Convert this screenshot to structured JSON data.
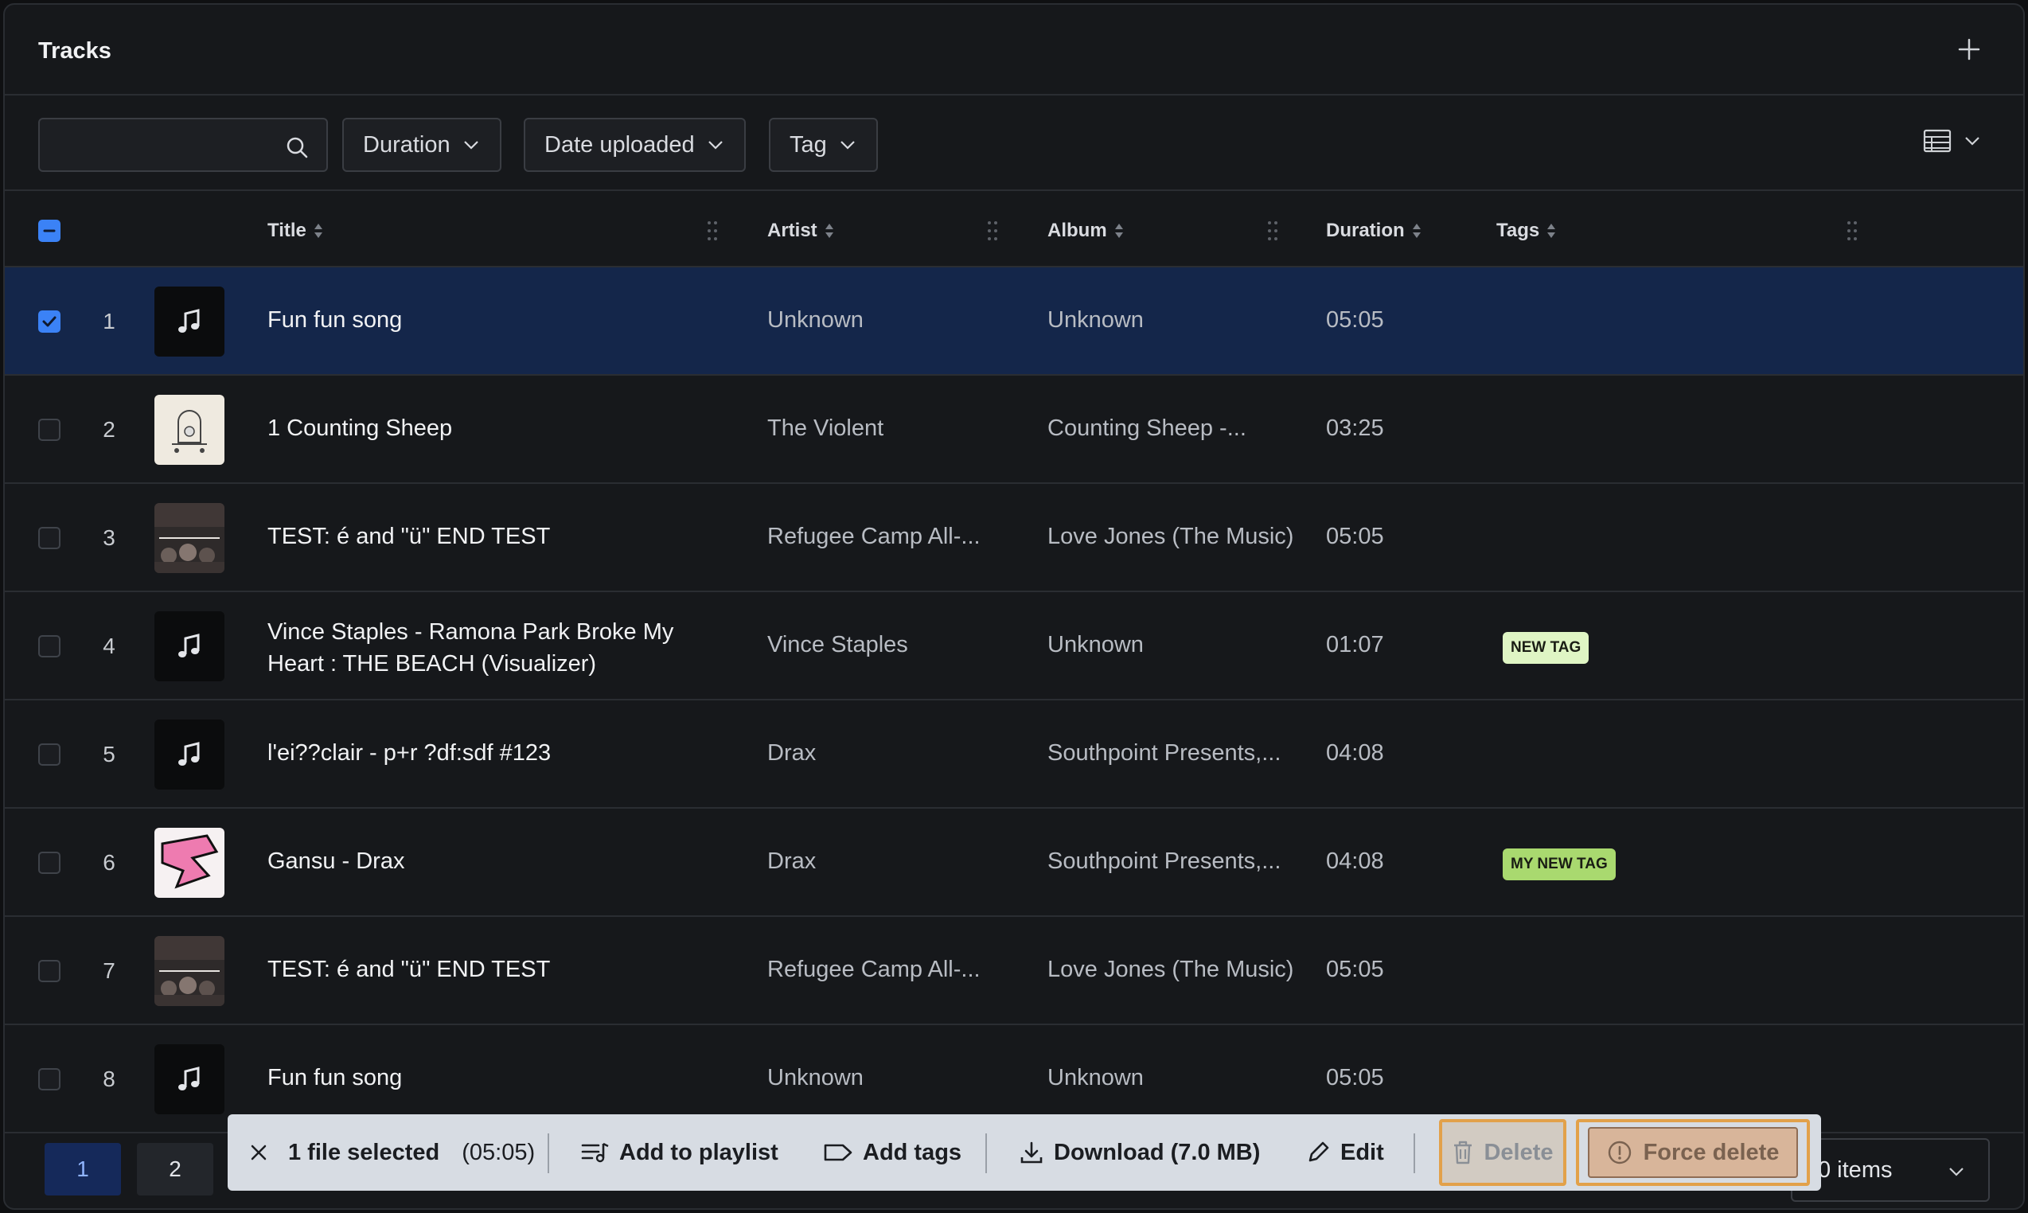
{
  "header": {
    "title": "Tracks"
  },
  "filters": {
    "search_placeholder": "",
    "duration_label": "Duration",
    "date_label": "Date uploaded",
    "tag_label": "Tag"
  },
  "columns": {
    "title": "Title",
    "artist": "Artist",
    "album": "Album",
    "duration": "Duration",
    "tags": "Tags"
  },
  "rows": [
    {
      "num": "1",
      "title": "Fun fun song",
      "artist": "Unknown",
      "album": "Unknown",
      "duration": "05:05",
      "tag": "",
      "selected": true,
      "art": "music-note"
    },
    {
      "num": "2",
      "title": "1 Counting Sheep",
      "artist": "The Violent",
      "album": "Counting Sheep -...",
      "duration": "03:25",
      "tag": "",
      "selected": false,
      "art": "sheep-cover"
    },
    {
      "num": "3",
      "title": "TEST: é and \"ü\" END TEST",
      "artist": "Refugee Camp All-...",
      "album": "Love Jones (The Music)",
      "duration": "05:05",
      "tag": "",
      "selected": false,
      "art": "jones-cover"
    },
    {
      "num": "4",
      "title": "Vince Staples - Ramona Park Broke My Heart : THE BEACH (Visualizer)",
      "artist": "Vince Staples",
      "album": "Unknown",
      "duration": "01:07",
      "tag": "NEW TAG",
      "selected": false,
      "art": "music-note"
    },
    {
      "num": "5",
      "title": "l'ei??clair - p+r ?df:sdf #123",
      "artist": "Drax",
      "album": "Southpoint Presents,...",
      "duration": "04:08",
      "tag": "",
      "selected": false,
      "art": "music-note"
    },
    {
      "num": "6",
      "title": "Gansu - Drax",
      "artist": "Drax",
      "album": "Southpoint Presents,...",
      "duration": "04:08",
      "tag": "MY NEW TAG",
      "selected": false,
      "art": "pink-cover"
    },
    {
      "num": "7",
      "title": "TEST: é and \"ü\" END TEST",
      "artist": "Refugee Camp All-...",
      "album": "Love Jones (The Music)",
      "duration": "05:05",
      "tag": "",
      "selected": false,
      "art": "jones-cover"
    },
    {
      "num": "8",
      "title": "Fun fun song",
      "artist": "Unknown",
      "album": "Unknown",
      "duration": "05:05",
      "tag": "",
      "selected": false,
      "art": "music-note"
    }
  ],
  "tag_colors": {
    "NEW TAG": "#dff5c4",
    "MY NEW TAG": "#a9d96f"
  },
  "pagination": {
    "page1": "1",
    "page2": "2",
    "items_label": "0 items"
  },
  "action_bar": {
    "selected_label": "1 file selected",
    "selected_duration": "(05:05)",
    "add_to_playlist": "Add to playlist",
    "add_tags": "Add tags",
    "download": "Download (7.0 MB)",
    "edit": "Edit",
    "delete": "Delete",
    "force_delete": "Force delete"
  },
  "colors": {
    "accent": "#3b82f6",
    "selected_row": "#14264a",
    "danger_outline": "#e2a14a"
  }
}
